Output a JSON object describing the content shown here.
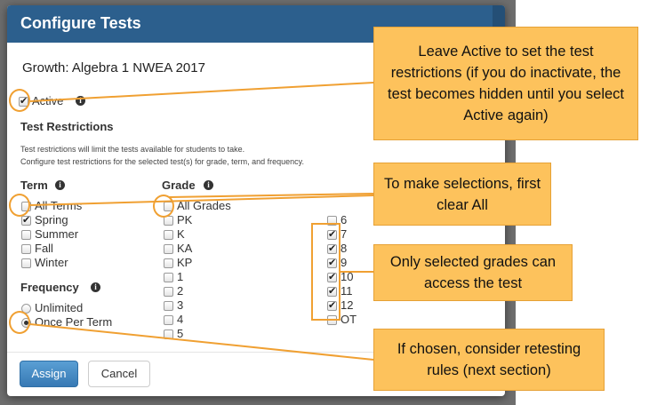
{
  "modal": {
    "title": "Configure Tests",
    "test_name": "Growth: Algebra 1 NWEA 2017",
    "active_label": "Active",
    "restrictions_heading": "Test Restrictions",
    "help_line1": "Test restrictions will limit the tests available for students to take.",
    "help_line2": "Configure test restrictions for the selected test(s) for grade, term, and frequency."
  },
  "term": {
    "heading": "Term",
    "options": [
      {
        "label": "All Terms",
        "checked": false
      },
      {
        "label": "Spring",
        "checked": true
      },
      {
        "label": "Summer",
        "checked": false
      },
      {
        "label": "Fall",
        "checked": false
      },
      {
        "label": "Winter",
        "checked": false
      }
    ]
  },
  "frequency": {
    "heading": "Frequency",
    "options": [
      {
        "label": "Unlimited",
        "selected": false
      },
      {
        "label": "Once Per Term",
        "selected": true
      }
    ]
  },
  "grade": {
    "heading": "Grade",
    "col1": [
      {
        "label": "All Grades",
        "checked": false
      },
      {
        "label": "PK",
        "checked": false
      },
      {
        "label": "K",
        "checked": false
      },
      {
        "label": "KA",
        "checked": false
      },
      {
        "label": "KP",
        "checked": false
      },
      {
        "label": "1",
        "checked": false
      },
      {
        "label": "2",
        "checked": false
      },
      {
        "label": "3",
        "checked": false
      },
      {
        "label": "4",
        "checked": false
      },
      {
        "label": "5",
        "checked": false
      }
    ],
    "col2": [
      {
        "label": "6",
        "checked": false
      },
      {
        "label": "7",
        "checked": true
      },
      {
        "label": "8",
        "checked": true
      },
      {
        "label": "9",
        "checked": true
      },
      {
        "label": "10",
        "checked": true
      },
      {
        "label": "11",
        "checked": true
      },
      {
        "label": "12",
        "checked": true
      },
      {
        "label": "OT",
        "checked": false
      }
    ]
  },
  "buttons": {
    "assign": "Assign",
    "cancel": "Cancel"
  },
  "callouts": {
    "active": "Leave Active to set the test restrictions (if you do inactivate, the test becomes hidden until you select Active again)",
    "clear_all": "To make selections, first clear All",
    "grades": "Only selected grades can access the test",
    "retest": "If chosen, consider retesting rules (next section)"
  },
  "colors": {
    "header": "#2c5f8d",
    "callout": "#fdc25c",
    "callout_border": "#f0a032",
    "assign_button": "#3779b4"
  }
}
